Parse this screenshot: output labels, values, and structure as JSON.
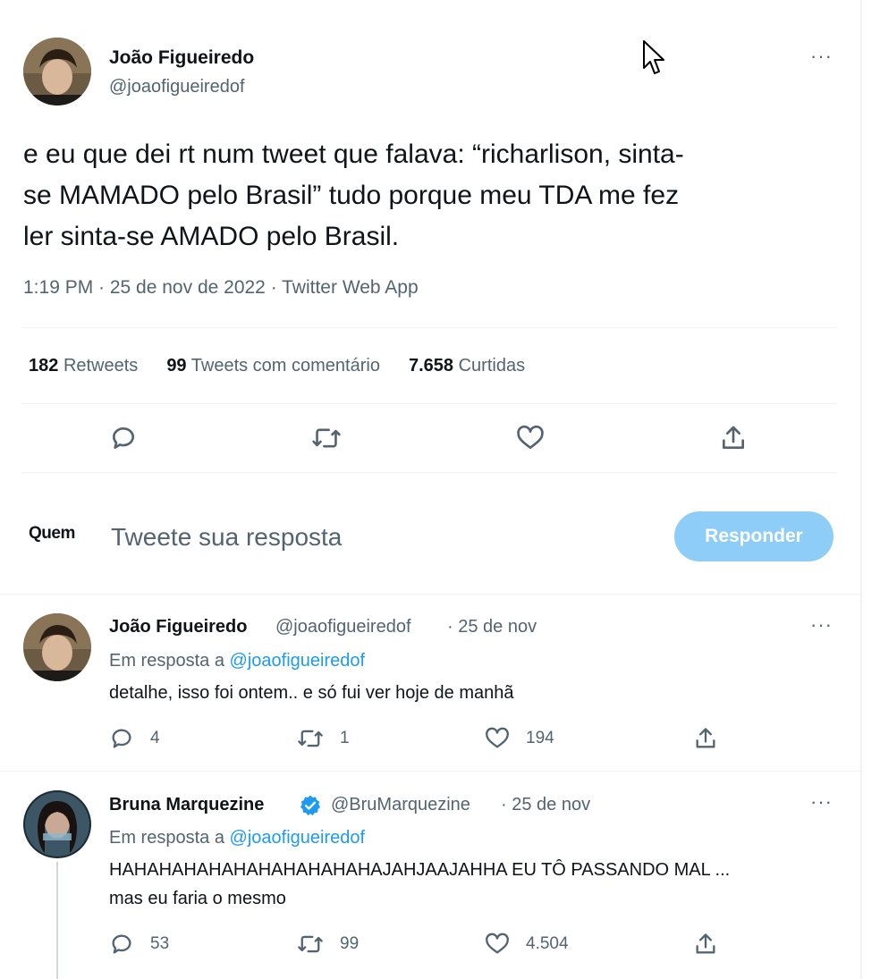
{
  "main_tweet": {
    "author_name": "João Figueiredo",
    "author_handle": "@joaofigueiredof",
    "text_lines": [
      "e eu que dei rt num tweet que falava: “richarlison, sinta-",
      "se MAMADO pelo Brasil” tudo porque meu TDA me fez",
      "ler sinta-se AMADO pelo Brasil."
    ],
    "meta": "1:19 PM · 25 de nov de 2022 · Twitter Web App",
    "stats": {
      "retweets_count": "182",
      "retweets_label": "Retweets",
      "quotes_count": "99",
      "quotes_label": "Tweets com comentário",
      "likes_count": "7.658",
      "likes_label": "Curtidas"
    },
    "more_glyph": "···"
  },
  "reply_box": {
    "who_label": "Quem",
    "placeholder": "Tweete sua resposta",
    "button_label": "Responder"
  },
  "replies": [
    {
      "author_name": "João Figueiredo",
      "author_handle": "@joaofigueiredof",
      "date": "· 25 de nov",
      "in_reply_prefix": "Em resposta a ",
      "in_reply_handle": "@joaofigueiredof",
      "text_lines": [
        "detalhe, isso foi ontem.. e só fui ver hoje de manhã"
      ],
      "reply_count": "4",
      "retweet_count": "1",
      "like_count": "194",
      "verified": false
    },
    {
      "author_name": "Bruna Marquezine",
      "author_handle": "@BruMarquezine",
      "date": "· 25 de nov",
      "in_reply_prefix": "Em resposta a ",
      "in_reply_handle": "@joaofigueiredof",
      "text_lines": [
        "HAHAHAHAHAHAHAHAHAHAHAJAHJAAJAHHA EU TÔ PASSANDO MAL ...",
        "mas eu faria o mesmo"
      ],
      "reply_count": "53",
      "retweet_count": "99",
      "like_count": "4.504",
      "verified": true
    }
  ],
  "colors": {
    "accent": "#1d9bf0",
    "secondary_text": "#536471",
    "button_disabled": "#8ecdf8",
    "verified_badge": "#1d9bf0"
  }
}
